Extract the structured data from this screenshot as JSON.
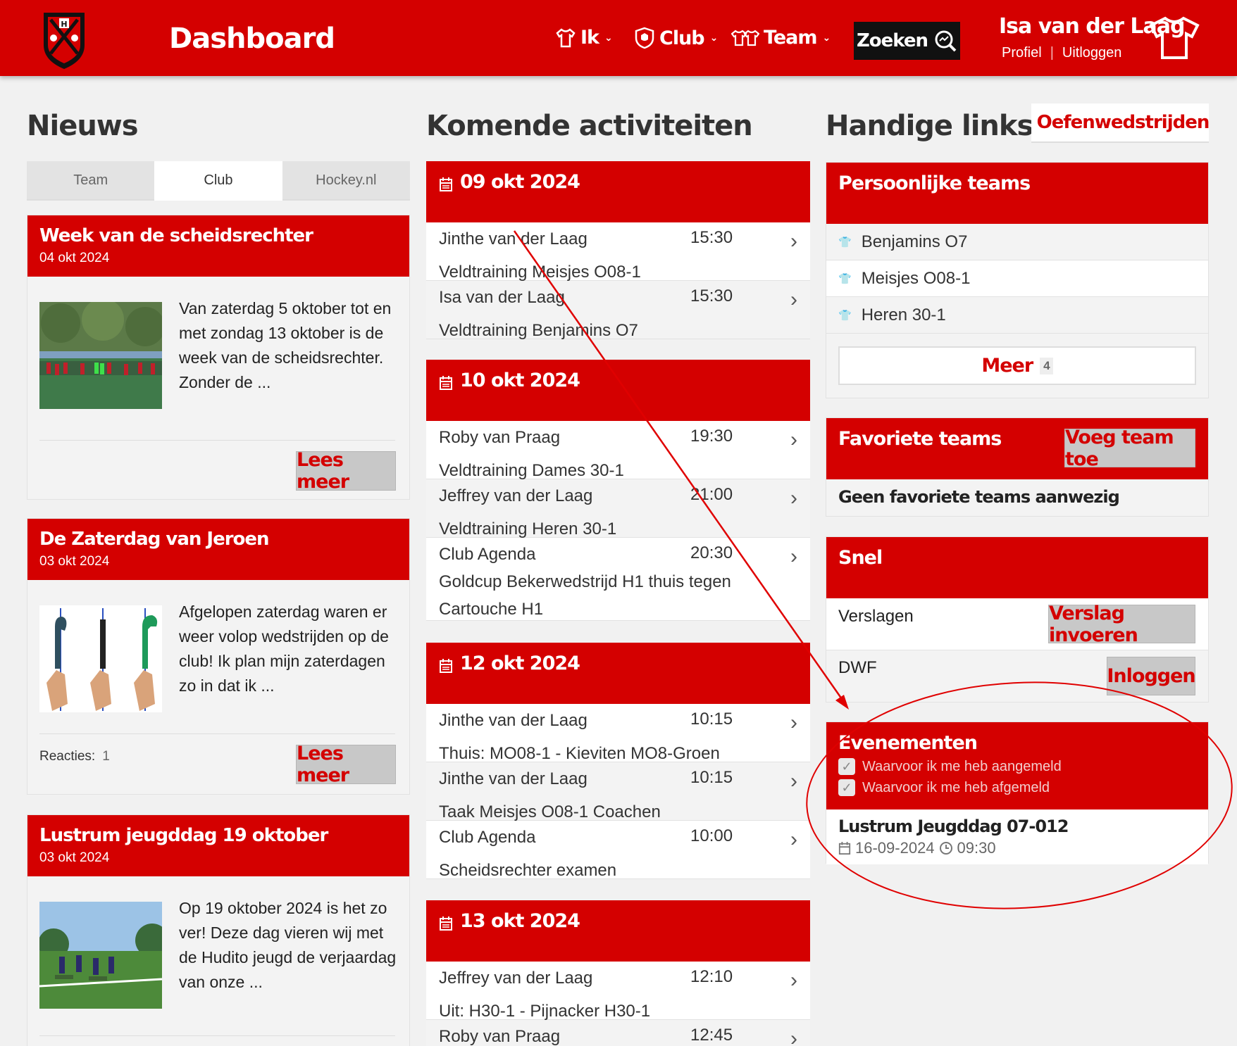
{
  "header": {
    "title": "Dashboard",
    "nav": [
      {
        "label": "Ik",
        "icon": "shirt-icon"
      },
      {
        "label": "Club",
        "icon": "shield-icon"
      },
      {
        "label": "Team",
        "icon": "team-shirts-icon"
      }
    ],
    "search_label": "Zoeken",
    "user_name": "Isa van der Laag",
    "profile_link": "Profiel",
    "logout_link": "Uitloggen",
    "accent": "#d40000"
  },
  "news": {
    "title": "Nieuws",
    "tabs": [
      "Team",
      "Club",
      "Hockey.nl"
    ],
    "active_tab": "Club",
    "read_more": "Lees meer",
    "reacties_label": "Reacties:",
    "items": [
      {
        "title": "Week van de scheidsrechter",
        "date": "04 okt 2024",
        "text": "Van zaterdag 5 oktober tot en met zondag 13 oktober is de week van de scheidsrechter. Zonder de ..."
      },
      {
        "title": "De Zaterdag van Jeroen",
        "date": "03 okt 2024",
        "text": "Afgelopen zaterdag waren er weer volop wedstrijden op de club! Ik plan mijn zaterdagen zo in dat ik ...",
        "reacties": "1"
      },
      {
        "title": "Lustrum jeugddag 19 oktober",
        "date": "03 okt 2024",
        "text": "Op 19 oktober 2024 is het zo ver! Deze dag vieren wij met de Hudito jeugd de verjaardag van onze ..."
      }
    ]
  },
  "activities": {
    "title": "Komende activiteiten",
    "days": [
      {
        "date": "09 okt 2024",
        "rows": [
          {
            "who": "Jinthe van der Laag",
            "time": "15:30",
            "what": "Veldtraining Meisjes O08-1"
          },
          {
            "who": "Isa van der Laag",
            "time": "15:30",
            "what": "Veldtraining Benjamins O7"
          }
        ]
      },
      {
        "date": "10 okt 2024",
        "rows": [
          {
            "who": "Roby van Praag",
            "time": "19:30",
            "what": "Veldtraining Dames 30-1"
          },
          {
            "who": "Jeffrey van der Laag",
            "time": "21:00",
            "what": "Veldtraining Heren 30-1"
          },
          {
            "who": "Club Agenda",
            "time": "20:30",
            "what": "Goldcup Bekerwedstrijd H1 thuis tegen Cartouche H1"
          }
        ]
      },
      {
        "date": "12 okt 2024",
        "rows": [
          {
            "who": "Jinthe van der Laag",
            "time": "10:15",
            "what": "Thuis: MO08-1 - Kieviten MO8-Groen"
          },
          {
            "who": "Jinthe van der Laag",
            "time": "10:15",
            "what": "Taak Meisjes O08-1 Coachen"
          },
          {
            "who": "Club Agenda",
            "time": "10:00",
            "what": "Scheidsrechter examen"
          }
        ]
      },
      {
        "date": "13 okt 2024",
        "rows": [
          {
            "who": "Jeffrey van der Laag",
            "time": "12:10",
            "what": "Uit: H30-1 - Pijnacker H30-1"
          },
          {
            "who": "Roby van Praag",
            "time": "12:45",
            "what": ""
          }
        ]
      }
    ]
  },
  "links": {
    "title": "Handige links",
    "oefen_label": "Oefenwedstrijden",
    "personal": {
      "title": "Persoonlijke teams",
      "teams": [
        "Benjamins O7",
        "Meisjes O08-1",
        "Heren 30-1"
      ],
      "meer_label": "Meer",
      "meer_count": "4"
    },
    "favorites": {
      "title": "Favoriete teams",
      "add_label": "Voeg team toe",
      "empty": "Geen favoriete teams aanwezig"
    },
    "snel": {
      "title": "Snel",
      "verslagen_label": "Verslagen",
      "verslag_btn": "Verslag invoeren",
      "dwf_label": "DWF",
      "dwf_btn": "Inloggen"
    },
    "events": {
      "title": "Evenementen",
      "filter_1": "Waarvoor ik me heb aangemeld",
      "filter_2": "Waarvoor ik me heb afgemeld",
      "event_name": "Lustrum Jeugddag 07-012",
      "event_date": "16-09-2024",
      "event_time": "09:30"
    }
  }
}
